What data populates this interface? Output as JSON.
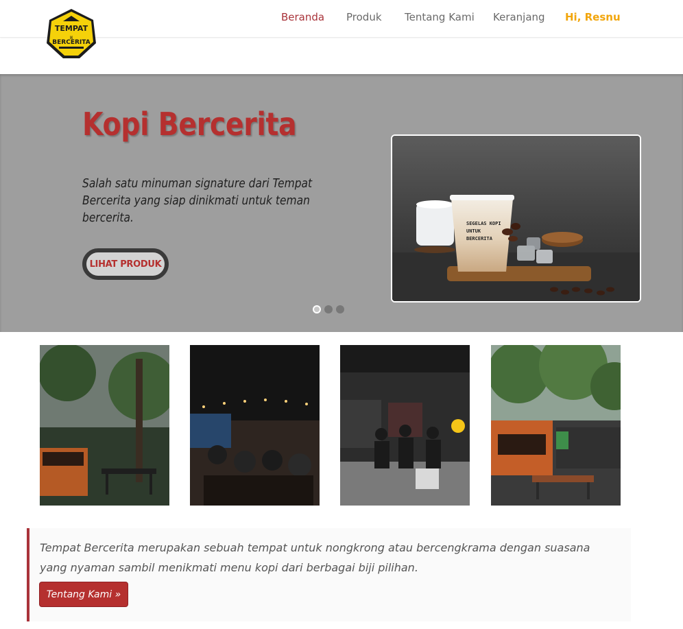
{
  "brand": {
    "logo_line1": "TEMPAT",
    "logo_line2": "BERCERITA",
    "logo_color": "#f5d10a"
  },
  "nav": {
    "items": [
      {
        "label": "Beranda",
        "active": true
      },
      {
        "label": "Produk"
      },
      {
        "label": "Tentang Kami"
      },
      {
        "label": "Keranjang"
      }
    ],
    "user_greeting": "Hi, Resnu"
  },
  "hero": {
    "title": "Kopi Bercerita",
    "description": "Salah satu minuman signature dari Tempat Bercerita yang siap dinikmati untuk teman bercerita.",
    "button_label": "LIHAT PRODUK",
    "cup_text": "SEGELAS KOPI UNTUK BERCERITA",
    "slide_count": 3,
    "active_slide": 1
  },
  "gallery": {
    "photos": [
      {
        "icon": "garden-cafe-photo"
      },
      {
        "icon": "night-crowd-photo"
      },
      {
        "icon": "live-music-photo"
      },
      {
        "icon": "outdoor-seating-photo"
      }
    ]
  },
  "about": {
    "text": "Tempat Bercerita merupakan sebuah tempat untuk nongkrong atau bercengkrama dengan suasana yang nyaman sambil menikmati menu kopi dari berbagai biji pilihan.",
    "button_label": "Tentang Kami »"
  },
  "colors": {
    "accent": "#a9333a",
    "user": "#f2a60c",
    "hero_bg": "#9e9e9e"
  }
}
